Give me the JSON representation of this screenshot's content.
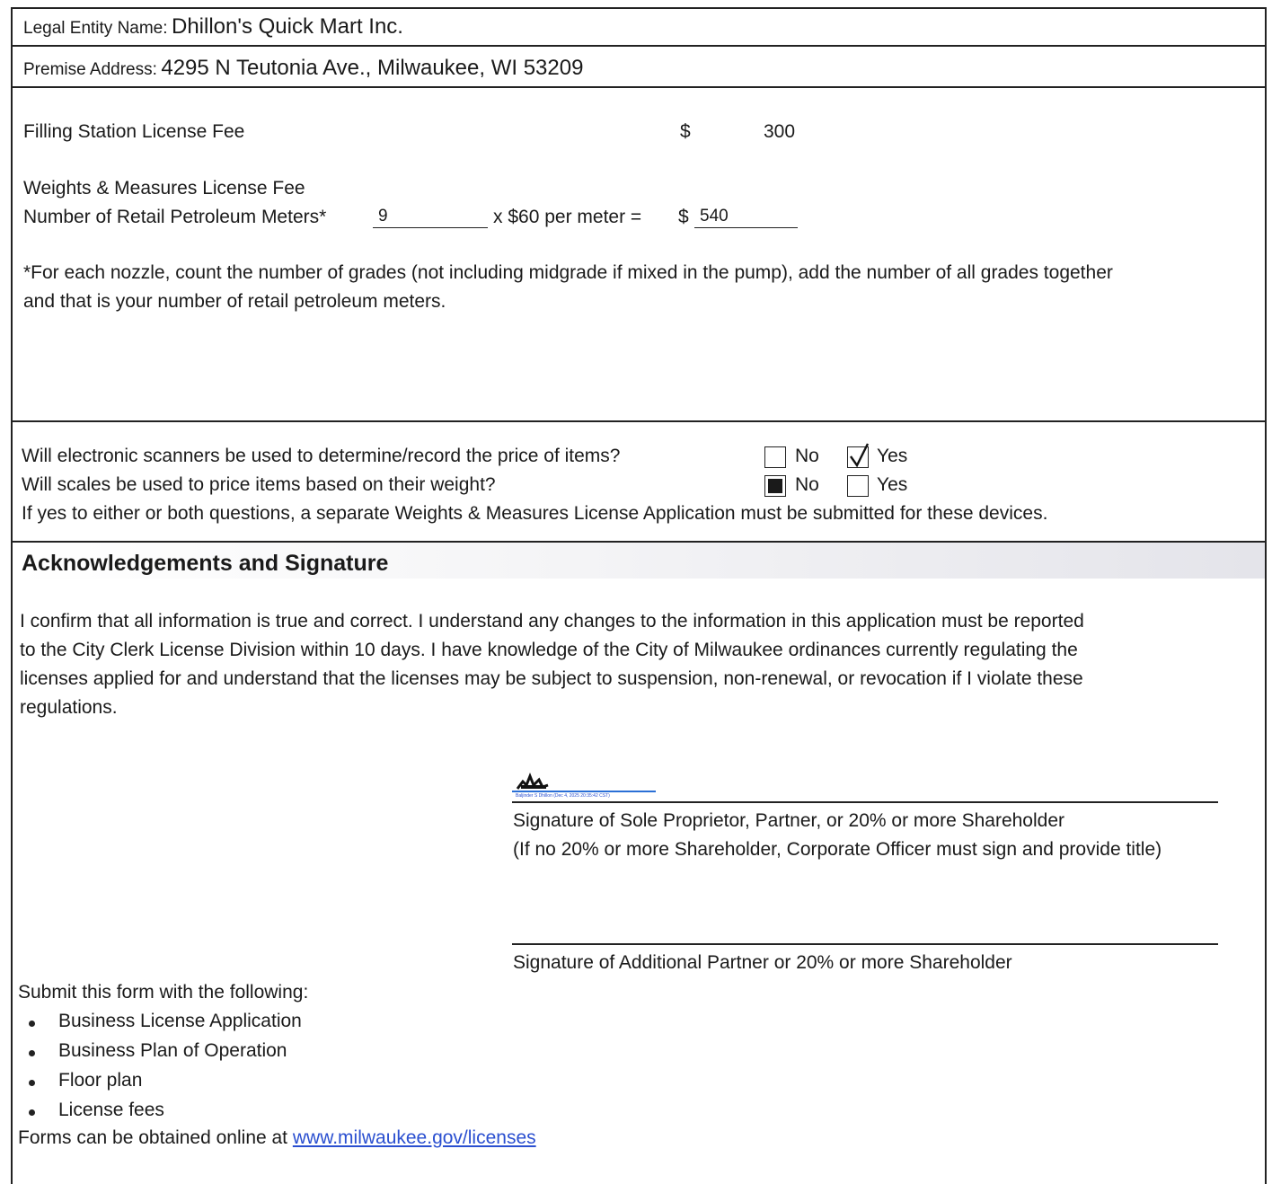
{
  "header": {
    "legal_entity_label": "Legal Entity Name:",
    "legal_entity_value": "Dhillon's Quick Mart Inc.",
    "premise_address_label": "Premise Address:",
    "premise_address_value": "4295 N Teutonia Ave., Milwaukee, WI 53209"
  },
  "fees": {
    "filling_station_label": "Filling Station License Fee",
    "filling_station_currency": "$",
    "filling_station_amount": "300",
    "weights_measures_label": "Weights & Measures License Fee",
    "meters_label": "Number of Retail Petroleum Meters*",
    "meters_value": "9",
    "per_meter_text": "x $60 per meter =",
    "meters_currency": "$",
    "meters_total": "540",
    "footnote_line1": "*For each nozzle, count the number of grades (not including midgrade if mixed in the pump), add the number of all grades together",
    "footnote_line2": "and that is your number of retail petroleum meters."
  },
  "devices": {
    "scanners_question": "Will electronic scanners be used to determine/record the price of items?",
    "scales_question": "Will scales be used to price items based on their weight?",
    "no_label": "No",
    "yes_label": "Yes",
    "scanners_answer": "Yes",
    "scales_answer": "No",
    "note": "If yes to either or both questions, a separate Weights & Measures License Application must be submitted for these devices."
  },
  "acknowledgement": {
    "title": "Acknowledgements and Signature",
    "line1": "I confirm that all information is true and correct.  I understand any changes to the information in this application must be reported",
    "line2": "to the City Clerk License Division within 10 days.  I have knowledge of the City of Milwaukee ordinances currently regulating the",
    "line3": "licenses applied for and understand that the licenses may be subject to suspension, non-renewal, or revocation if I violate these",
    "line4": "regulations."
  },
  "signatures": {
    "esign_stamp_text": "Baljinder S Dhillon (Dec 4, 2025 20:35:42 CST)",
    "sig1_caption_line1": "Signature of Sole Proprietor, Partner, or 20% or more Shareholder",
    "sig1_caption_line2": "(If no 20% or more Shareholder, Corporate Officer must sign and provide title)",
    "sig2_caption": "Signature of Additional Partner or 20% or more Shareholder"
  },
  "submit": {
    "intro": "Submit this form with the following:",
    "items": [
      "Business License Application",
      "Business Plan of Operation",
      "Floor plan",
      "License fees"
    ],
    "forms_text": "Forms can be obtained online at ",
    "forms_link": "www.milwaukee.gov/licenses"
  }
}
